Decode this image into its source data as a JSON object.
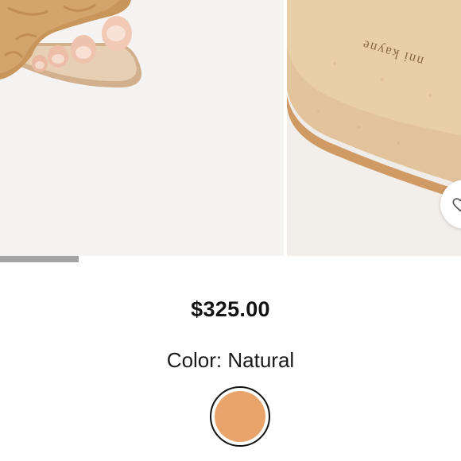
{
  "gallery": {
    "images": [
      {
        "alt": ""
      },
      {
        "alt": "",
        "insole_text": "nni kayne"
      }
    ],
    "progress_fraction": 0.17
  },
  "product": {
    "price": "$325.00",
    "color_label": "Color: Natural",
    "swatches": [
      {
        "name": "Natural",
        "color": "#e9a46c",
        "selected": true
      }
    ]
  },
  "icons": {
    "wishlist": "heart-icon"
  }
}
